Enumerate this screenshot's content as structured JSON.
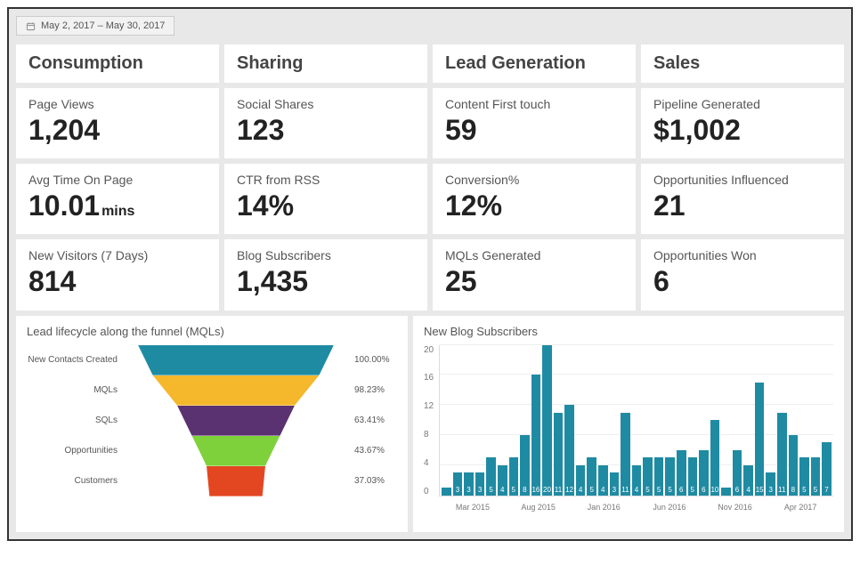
{
  "date_range": "May 2, 2017  –  May 30, 2017",
  "columns": {
    "consumption": "Consumption",
    "sharing": "Sharing",
    "lead_gen": "Lead Generation",
    "sales": "Sales"
  },
  "metrics": {
    "page_views": {
      "label": "Page Views",
      "value": "1,204"
    },
    "social_shares": {
      "label": "Social Shares",
      "value": "123"
    },
    "content_first": {
      "label": "Content First touch",
      "value": "59"
    },
    "pipeline": {
      "label": "Pipeline Generated",
      "value": "$1,002"
    },
    "avg_time": {
      "label": "Avg Time On Page",
      "value": "10.01",
      "unit": "mins"
    },
    "ctr_rss": {
      "label": "CTR from RSS",
      "value": "14%"
    },
    "conversion": {
      "label": "Conversion%",
      "value": "12%"
    },
    "opps_infl": {
      "label": "Opportunities Influenced",
      "value": "21"
    },
    "new_visitors": {
      "label": "New Visitors (7 Days)",
      "value": "814"
    },
    "blog_subs": {
      "label": "Blog Subscribers",
      "value": "1,435"
    },
    "mqls": {
      "label": "MQLs Generated",
      "value": "25"
    },
    "opps_won": {
      "label": "Opportunities Won",
      "value": "6"
    }
  },
  "funnel": {
    "title": "Lead lifecycle along the funnel (MQLs)",
    "stages": [
      {
        "label": "New Contacts Created",
        "pct": "100.00%",
        "width": 100,
        "color": "#1f8ba3"
      },
      {
        "label": "MQLs",
        "pct": "98.23%",
        "width": 85,
        "color": "#f5b72b"
      },
      {
        "label": "SQLs",
        "pct": "63.41%",
        "width": 60,
        "color": "#5a3271"
      },
      {
        "label": "Opportunities",
        "pct": "43.67%",
        "width": 45,
        "color": "#7fd13b"
      },
      {
        "label": "Customers",
        "pct": "37.03%",
        "width": 30,
        "color": "#e34722"
      }
    ]
  },
  "chart_data": {
    "type": "bar",
    "title": "New Blog Subscribers",
    "ylabel": "",
    "xlabel": "",
    "ylim": [
      0,
      20
    ],
    "yticks": [
      0,
      4,
      8,
      12,
      16,
      20
    ],
    "xticks": [
      "Mar 2015",
      "Aug 2015",
      "Jan 2016",
      "Jun 2016",
      "Nov 2016",
      "Apr 2017"
    ],
    "values": [
      1,
      3,
      3,
      3,
      5,
      4,
      5,
      8,
      16,
      20,
      11,
      12,
      4,
      5,
      4,
      3,
      11,
      4,
      5,
      5,
      5,
      6,
      5,
      6,
      10,
      1,
      6,
      4,
      15,
      3,
      11,
      8,
      5,
      5,
      7
    ]
  }
}
